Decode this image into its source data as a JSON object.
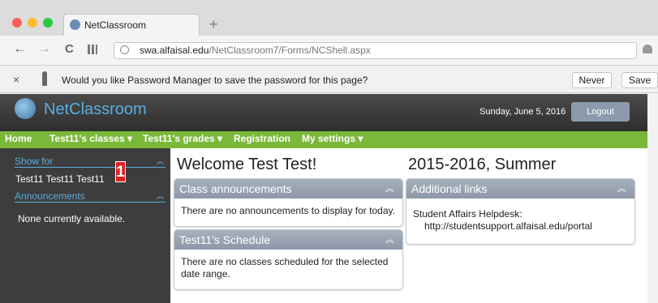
{
  "browser": {
    "tab_title": "NetClassroom",
    "new_tab": "+",
    "url_host": "swa.alfaisal.edu",
    "url_path": "/NetClassroom7/Forms/NCShell.aspx",
    "back": "←",
    "forward": "→",
    "reload": "C"
  },
  "password_bar": {
    "close": "×",
    "message": "Would you like Password Manager to save the password for this page?",
    "never": "Never",
    "save": "Save"
  },
  "header": {
    "brand": "NetClassroom",
    "date": "Sunday, June 5, 2016",
    "logout": "Logout"
  },
  "menu": {
    "home": "Home",
    "classes": "Test11's classes ▾",
    "grades": "Test11's grades ▾",
    "registration": "Registration",
    "settings": "My settings ▾"
  },
  "sidebar": {
    "show_for": "Show for",
    "student": "Test11 Test11 Test11",
    "announcements": "Announcements",
    "none": "None currently available.",
    "badge": "1"
  },
  "main": {
    "welcome": "Welcome Test Test!",
    "term": "2015-2016, Summer",
    "class_announcements": {
      "title": "Class announcements",
      "body": "There are no announcements to display for today."
    },
    "schedule": {
      "title": "Test11's Schedule",
      "body": "There are no classes scheduled for the selected date range."
    },
    "links": {
      "title": "Additional links",
      "label": "Student Affairs Helpdesk:",
      "url": "http://studentsupport.alfaisal.edu/portal"
    }
  },
  "colors": {
    "menu_green": "#7ab83a",
    "brand_blue": "#5aaee0",
    "panel_header": "#98a2b1",
    "badge_red": "#e02020"
  }
}
